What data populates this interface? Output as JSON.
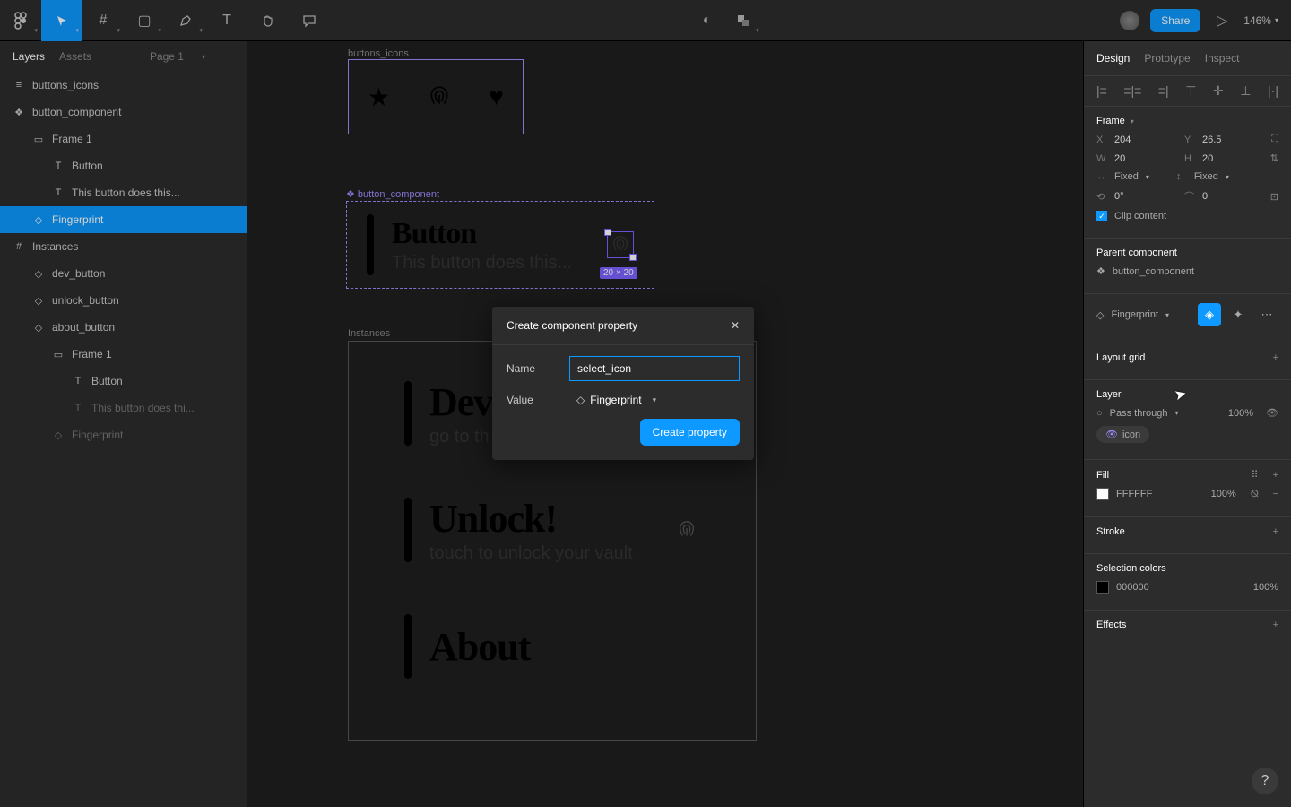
{
  "toolbar": {
    "share_label": "Share",
    "zoom": "146%"
  },
  "left_panel": {
    "tabs": [
      "Layers",
      "Assets"
    ],
    "page": "Page 1",
    "layers": [
      {
        "icon": "≡",
        "name": "buttons_icons",
        "indent": 0
      },
      {
        "icon": "❖",
        "name": "button_component",
        "indent": 0
      },
      {
        "icon": "▭",
        "name": "Frame 1",
        "indent": 1
      },
      {
        "icon": "T",
        "name": "Button",
        "indent": 2
      },
      {
        "icon": "T",
        "name": "This button does this...",
        "indent": 2
      },
      {
        "icon": "◇",
        "name": "Fingerprint",
        "indent": 1,
        "selected": true
      },
      {
        "icon": "#",
        "name": "Instances",
        "indent": 0
      },
      {
        "icon": "◇",
        "name": "dev_button",
        "indent": 1
      },
      {
        "icon": "◇",
        "name": "unlock_button",
        "indent": 1
      },
      {
        "icon": "◇",
        "name": "about_button",
        "indent": 1
      },
      {
        "icon": "▭",
        "name": "Frame 1",
        "indent": 2
      },
      {
        "icon": "T",
        "name": "Button",
        "indent": 3
      },
      {
        "icon": "T",
        "name": "This button does thi...",
        "indent": 3,
        "dim": true
      },
      {
        "icon": "◇",
        "name": "Fingerprint",
        "indent": 2,
        "dim": true
      }
    ]
  },
  "canvas": {
    "icons_label": "buttons_icons",
    "component_label": "button_component",
    "instances_label": "Instances",
    "button_title": "Button",
    "button_subtitle": "This button does this...",
    "selection_size": "20 × 20",
    "instances": [
      {
        "title": "Dev",
        "subtitle": "go to th",
        "show_fp": false
      },
      {
        "title": "Unlock!",
        "subtitle": "touch to unlock your vault",
        "show_fp": true
      },
      {
        "title": "About",
        "subtitle": "",
        "show_fp": false
      }
    ]
  },
  "right_panel": {
    "tabs": [
      "Design",
      "Prototype",
      "Inspect"
    ],
    "frame": {
      "title": "Frame",
      "X": "204",
      "Y": "26.5",
      "W": "20",
      "H": "20",
      "hmode": "Fixed",
      "vmode": "Fixed",
      "rotation": "0°",
      "radius": "0",
      "clip_label": "Clip content"
    },
    "parent_section_title": "Parent component",
    "parent_name": "button_component",
    "instance_name": "Fingerprint",
    "layout_grid_title": "Layout grid",
    "layer_title": "Layer",
    "blend_mode": "Pass through",
    "opacity": "100%",
    "layer_tag": "icon",
    "fill_title": "Fill",
    "fill_hex": "FFFFFF",
    "fill_opacity": "100%",
    "stroke_title": "Stroke",
    "selcolors_title": "Selection colors",
    "selcolor_hex": "000000",
    "selcolor_opacity": "100%",
    "effects_title": "Effects"
  },
  "modal": {
    "title": "Create component property",
    "name_label": "Name",
    "name_value": "select_icon",
    "value_label": "Value",
    "value_select": "Fingerprint",
    "submit_label": "Create property"
  }
}
